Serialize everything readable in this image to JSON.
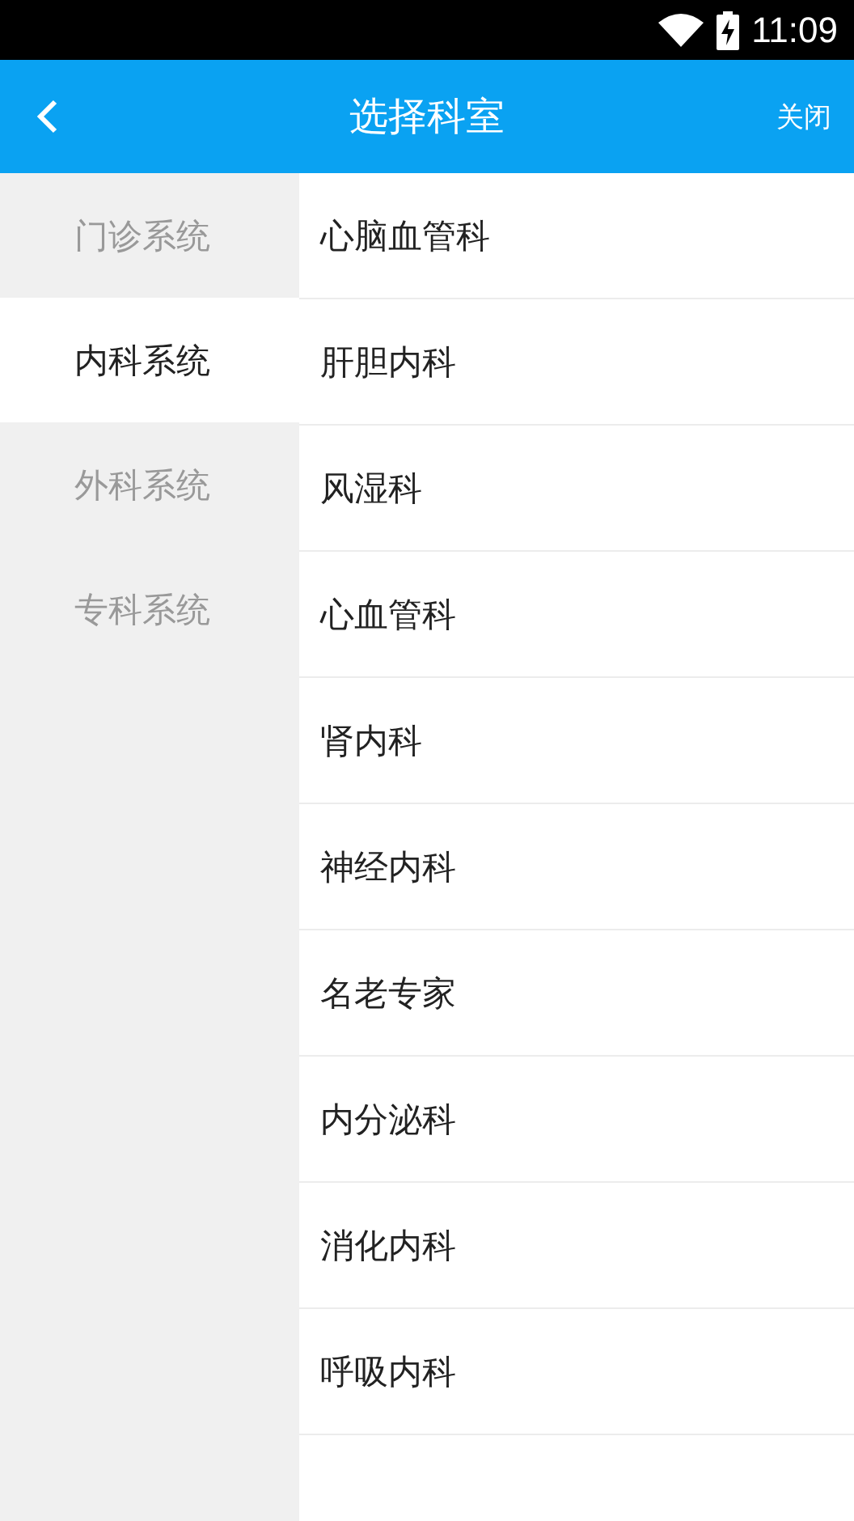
{
  "status_bar": {
    "time": "11:09"
  },
  "header": {
    "title": "选择科室",
    "close": "关闭"
  },
  "sidebar": {
    "items": [
      {
        "label": "门诊系统",
        "selected": false
      },
      {
        "label": "内科系统",
        "selected": true
      },
      {
        "label": "外科系统",
        "selected": false
      },
      {
        "label": "专科系统",
        "selected": false
      }
    ]
  },
  "departments": [
    "心脑血管科",
    "肝胆内科",
    "风湿科",
    "心血管科",
    "肾内科",
    "神经内科",
    "名老专家",
    "内分泌科",
    "消化内科",
    "呼吸内科"
  ]
}
